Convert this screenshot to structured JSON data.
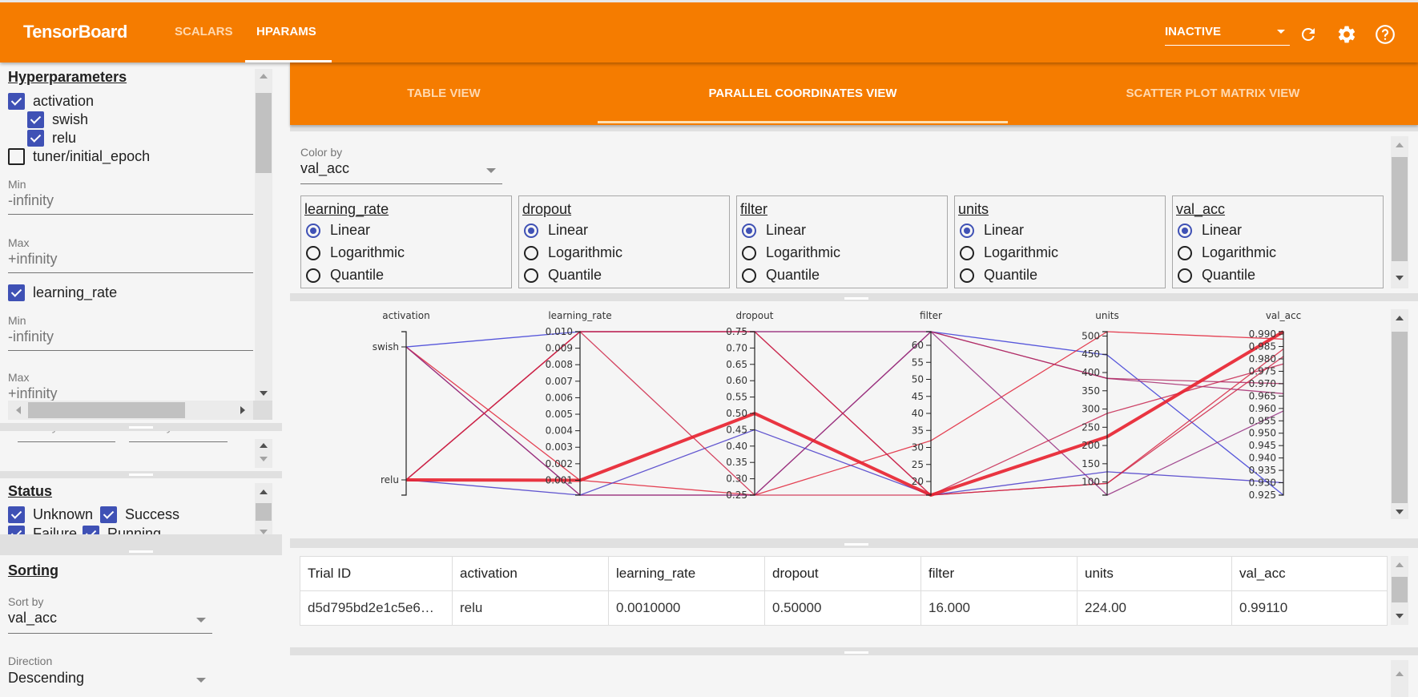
{
  "app": {
    "title": "TensorBoard",
    "nav_tabs": [
      {
        "label": "SCALARS",
        "active": false
      },
      {
        "label": "HPARAMS",
        "active": true
      }
    ],
    "run_selector": {
      "value": "INACTIVE"
    },
    "icons": {
      "refresh": "refresh-icon",
      "settings": "gear-icon",
      "help": "help-icon"
    },
    "accent_color": "#f57c00",
    "checkbox_color": "#3f51b5"
  },
  "sidebar": {
    "hyperparameters": {
      "title": "Hyperparameters",
      "items": [
        {
          "label": "activation",
          "checked": true
        },
        {
          "label": "swish",
          "checked": true
        },
        {
          "label": "relu",
          "checked": true
        },
        {
          "label": "tuner/initial_epoch",
          "checked": false
        },
        {
          "label": "learning_rate",
          "checked": true
        }
      ],
      "initial_epoch_min_label": "Min",
      "initial_epoch_min": "-infinity",
      "initial_epoch_max_label": "Max",
      "initial_epoch_max": "+infinity",
      "lr_min_label": "Min",
      "lr_min": "-infinity",
      "lr_max_label": "Max",
      "lr_max": "+infinity"
    },
    "metrics_partial": {
      "min": "-infinity",
      "max": "+infinity"
    },
    "status": {
      "title": "Status",
      "items": [
        {
          "label": "Unknown",
          "checked": true
        },
        {
          "label": "Success",
          "checked": true
        },
        {
          "label": "Failure",
          "checked": true
        },
        {
          "label": "Running",
          "checked": true
        }
      ]
    },
    "sorting": {
      "title": "Sorting",
      "sort_by_label": "Sort by",
      "sort_by_value": "val_acc",
      "direction_label": "Direction",
      "direction_value": "Descending"
    }
  },
  "main": {
    "view_tabs": [
      {
        "label": "TABLE VIEW",
        "active": false
      },
      {
        "label": "PARALLEL COORDINATES VIEW",
        "active": true
      },
      {
        "label": "SCATTER PLOT MATRIX VIEW",
        "active": false
      }
    ],
    "color_by": {
      "label": "Color by",
      "value": "val_acc"
    },
    "scale_options": [
      "Linear",
      "Logarithmic",
      "Quantile"
    ],
    "scales": [
      {
        "name": "learning_rate",
        "selected": "Linear"
      },
      {
        "name": "dropout",
        "selected": "Linear"
      },
      {
        "name": "filter",
        "selected": "Linear"
      },
      {
        "name": "units",
        "selected": "Linear"
      },
      {
        "name": "val_acc",
        "selected": "Linear"
      }
    ],
    "table": {
      "columns": [
        "Trial ID",
        "activation",
        "learning_rate",
        "dropout",
        "filter",
        "units",
        "val_acc"
      ],
      "rows": [
        [
          "d5d795bd2e1c5e6…",
          "relu",
          "0.0010000",
          "0.50000",
          "16.000",
          "224.00",
          "0.99110"
        ]
      ]
    }
  },
  "chart_data": {
    "type": "parallel-coordinates",
    "title": "",
    "axes": [
      {
        "name": "activation",
        "kind": "categorical",
        "categories": [
          "swish",
          "relu"
        ],
        "tick_labels": [
          "swish",
          "relu"
        ]
      },
      {
        "name": "learning_rate",
        "kind": "linear",
        "range": [
          0.0001,
          0.01
        ],
        "tick_labels": [
          "0.010",
          "0.009",
          "0.008",
          "0.007",
          "0.006",
          "0.005",
          "0.004",
          "0.003",
          "0.002",
          "0.001"
        ],
        "ticks": [
          0.01,
          0.009,
          0.008,
          0.007,
          0.006,
          0.005,
          0.004,
          0.003,
          0.002,
          0.001
        ]
      },
      {
        "name": "dropout",
        "kind": "linear",
        "range": [
          0.25,
          0.75
        ],
        "tick_labels": [
          "0.75",
          "0.70",
          "0.65",
          "0.60",
          "0.55",
          "0.50",
          "0.45",
          "0.40",
          "0.35",
          "0.30",
          "0.25"
        ],
        "ticks": [
          0.75,
          0.7,
          0.65,
          0.6,
          0.55,
          0.5,
          0.45,
          0.4,
          0.35,
          0.3,
          0.25
        ]
      },
      {
        "name": "filter",
        "kind": "linear",
        "range": [
          16,
          64
        ],
        "tick_labels": [
          "60",
          "55",
          "50",
          "45",
          "40",
          "35",
          "30",
          "25",
          "20"
        ],
        "ticks": [
          60,
          55,
          50,
          45,
          40,
          35,
          30,
          25,
          20
        ]
      },
      {
        "name": "units",
        "kind": "linear",
        "range": [
          64,
          512
        ],
        "tick_labels": [
          "500",
          "450",
          "400",
          "350",
          "300",
          "250",
          "200",
          "150",
          "100"
        ],
        "ticks": [
          500,
          450,
          400,
          350,
          300,
          250,
          200,
          150,
          100
        ]
      },
      {
        "name": "val_acc",
        "kind": "linear",
        "range": [
          0.925,
          0.991
        ],
        "tick_labels": [
          "0.990",
          "0.985",
          "0.980",
          "0.975",
          "0.970",
          "0.965",
          "0.960",
          "0.955",
          "0.950",
          "0.945",
          "0.940",
          "0.935",
          "0.930",
          "0.925"
        ],
        "ticks": [
          0.99,
          0.985,
          0.98,
          0.975,
          0.97,
          0.965,
          0.96,
          0.955,
          0.95,
          0.945,
          0.94,
          0.935,
          0.93,
          0.925
        ]
      }
    ],
    "color_by": "val_acc",
    "color_low": "#3b3bd6",
    "color_high": "#e8202e",
    "lines": [
      {
        "values": [
          "relu",
          0.001,
          0.5,
          16,
          224,
          0.991
        ],
        "selected": true
      },
      {
        "values": [
          "swish",
          0.01,
          0.75,
          64,
          448,
          0.925
        ],
        "selected": false
      },
      {
        "values": [
          "swish",
          0.0001,
          0.25,
          64,
          384,
          0.966
        ],
        "selected": false
      },
      {
        "values": [
          "swish",
          0.001,
          0.25,
          32,
          512,
          0.988
        ],
        "selected": false
      },
      {
        "values": [
          "relu",
          0.01,
          0.75,
          64,
          384,
          0.97
        ],
        "selected": false
      },
      {
        "values": [
          "relu",
          0.01,
          0.75,
          16,
          96,
          0.984
        ],
        "selected": false
      },
      {
        "values": [
          "swish",
          0.0001,
          0.25,
          64,
          64,
          0.959
        ],
        "selected": false
      },
      {
        "values": [
          "relu",
          0.0001,
          0.45,
          16,
          128,
          0.93
        ],
        "selected": false
      },
      {
        "values": [
          "relu",
          0.01,
          0.75,
          16,
          288,
          0.978
        ],
        "selected": false
      },
      {
        "values": [
          "relu",
          0.01,
          0.25,
          16,
          96,
          0.981
        ],
        "selected": false
      }
    ]
  }
}
